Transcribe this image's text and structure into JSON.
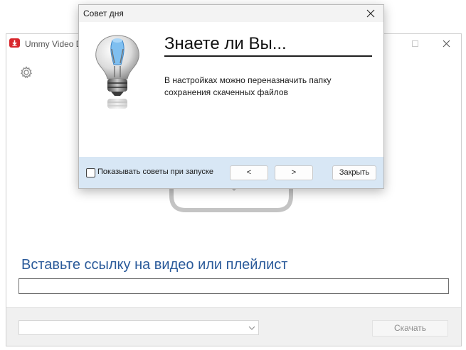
{
  "main_window": {
    "title": "Ummy Video D",
    "prompt": "Вставьте ссылку на видео или плейлист",
    "url_input_value": "",
    "format_select_value": "",
    "download_label": "Скачать"
  },
  "tip_dialog": {
    "title": "Совет дня",
    "heading": "Знаете ли Вы...",
    "text": "В настройках можно переназначить папку\nсохранения скаченных файлов",
    "show_tips_label": "Показывать советы при запуске",
    "show_tips_checked": false,
    "prev_label": "<",
    "next_label": ">",
    "close_label": "Закрыть"
  },
  "colors": {
    "prompt": "#2a5a9a",
    "footer": "#d8e7f5",
    "brand": "#d8262c"
  }
}
